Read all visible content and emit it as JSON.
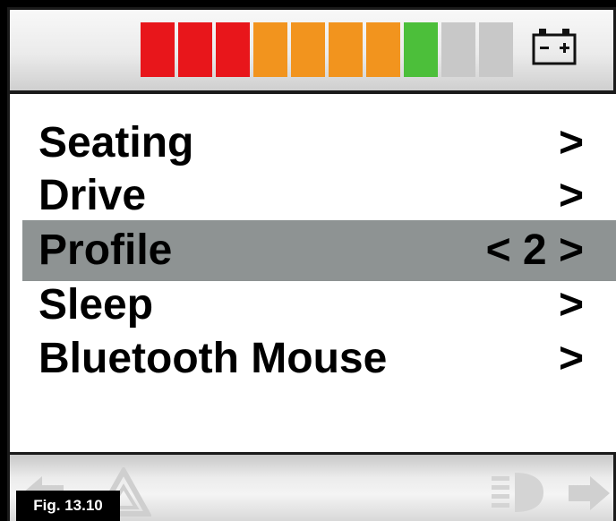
{
  "battery": {
    "segments": [
      {
        "color": "#e8161b"
      },
      {
        "color": "#e8161b"
      },
      {
        "color": "#e8161b"
      },
      {
        "color": "#f2941e"
      },
      {
        "color": "#f2941e"
      },
      {
        "color": "#f2941e"
      },
      {
        "color": "#f2941e"
      },
      {
        "color": "#4cbf3a"
      },
      {
        "color": "#c8c8c8"
      },
      {
        "color": "#c8c8c8"
      }
    ],
    "icon": "battery-icon"
  },
  "menu": {
    "items": [
      {
        "label": "Seating",
        "value": ">",
        "selected": false
      },
      {
        "label": "Drive",
        "value": ">",
        "selected": false
      },
      {
        "label": "Profile",
        "value": "< 2 >",
        "selected": true
      },
      {
        "label": "Sleep",
        "value": ">",
        "selected": false
      },
      {
        "label": "Bluetooth Mouse",
        "value": ">",
        "selected": false
      }
    ]
  },
  "bottom": {
    "icons": [
      "left-arrow-icon",
      "hazard-triangle-icon",
      "headlight-icon",
      "right-arrow-icon"
    ]
  },
  "figure": {
    "label": "Fig. 13.10"
  },
  "colors": {
    "selected_row": "#8e9393",
    "red": "#e8161b",
    "orange": "#f2941e",
    "green": "#4cbf3a",
    "empty": "#c8c8c8"
  }
}
